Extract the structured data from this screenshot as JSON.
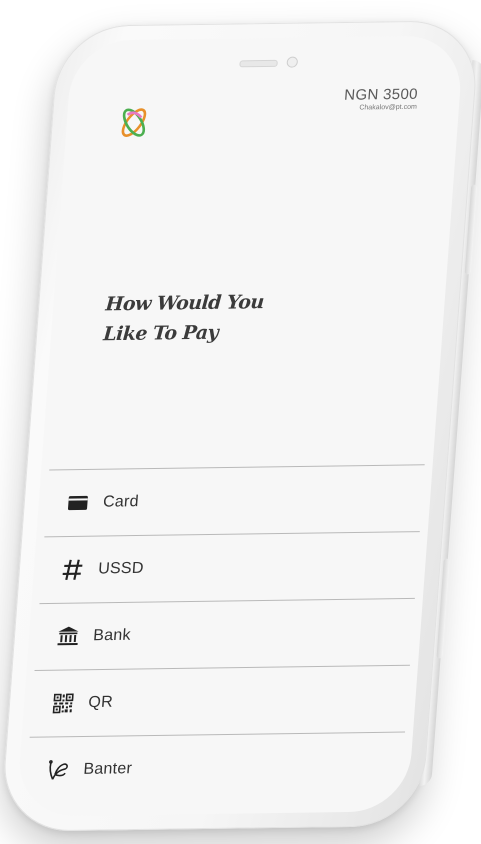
{
  "payment": {
    "amount": "NGN 3500",
    "email": "Chakalov@pt.com"
  },
  "headline": {
    "line1": "How Would You",
    "line2": "Like To Pay"
  },
  "options": [
    {
      "label": "Card",
      "icon": "card-icon"
    },
    {
      "label": "USSD",
      "icon": "hash-icon"
    },
    {
      "label": "Bank",
      "icon": "bank-icon"
    },
    {
      "label": "QR",
      "icon": "qr-code-icon"
    },
    {
      "label": "Banter",
      "icon": "banter-icon"
    }
  ],
  "colors": {
    "logo_orange": "#e8902a",
    "logo_green": "#4caf50",
    "logo_pink": "#e879c2"
  }
}
